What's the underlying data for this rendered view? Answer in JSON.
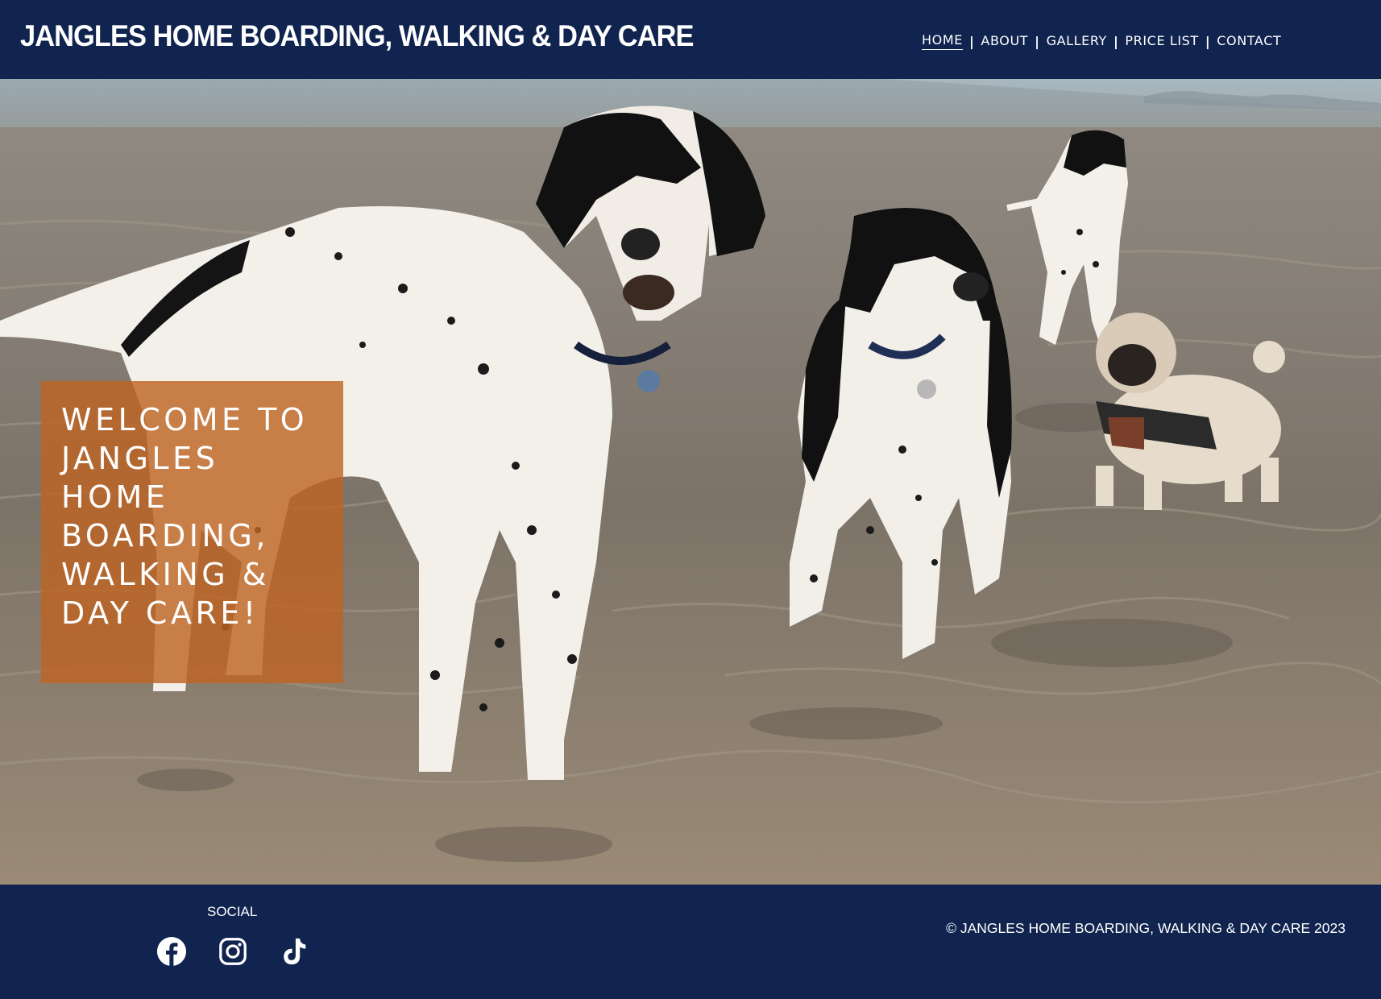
{
  "header": {
    "site_title": "JANGLES HOME BOARDING, WALKING & DAY CARE",
    "nav": [
      {
        "label": "HOME",
        "active": true
      },
      {
        "label": "ABOUT",
        "active": false
      },
      {
        "label": "GALLERY",
        "active": false
      },
      {
        "label": "PRICE LIST",
        "active": false
      },
      {
        "label": "CONTACT",
        "active": false
      }
    ],
    "nav_separator": "|"
  },
  "hero": {
    "image": "dogs-on-beach-photo",
    "welcome_text": "WELCOME TO JANGLES HOME BOARDING, WALKING & DAY CARE!"
  },
  "footer": {
    "social_label": "SOCIAL",
    "social_icons": [
      "facebook-icon",
      "instagram-icon",
      "tiktok-icon"
    ],
    "copyright": "© JANGLES HOME BOARDING, WALKING & DAY CARE 2023"
  },
  "colors": {
    "navy": "#10244f",
    "orange_overlay": "#be6423",
    "text": "#ffffff"
  }
}
